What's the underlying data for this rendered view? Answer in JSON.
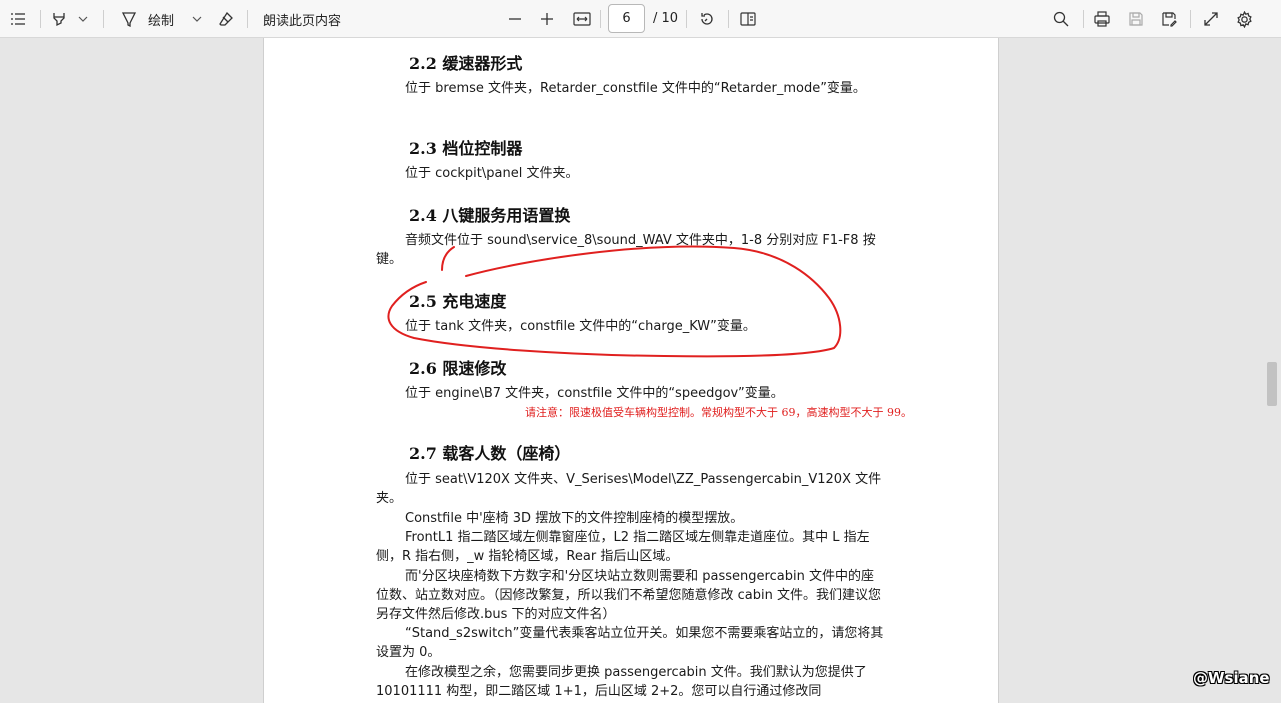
{
  "toolbar": {
    "draw_label": "绘制",
    "read_aloud_label": "朗读此页内容",
    "page_current": "6",
    "page_total": "/ 10"
  },
  "document": {
    "s22_title": "2.2 缓速器形式",
    "s22_body": "位于 bremse 文件夹，Retarder_constfile 文件中的“Retarder_mode”变量。",
    "s23_title": "2.3 档位控制器",
    "s23_body": "位于 cockpit\\panel 文件夹。",
    "s24_title": "2.4 八键服务用语置换",
    "s24_body": "音频文件位于 sound\\service_8\\sound_WAV 文件夹中，1-8 分别对应 F1-F8 按键。",
    "s25_title": "2.5 充电速度",
    "s25_body": "位于 tank 文件夹，constfile 文件中的“charge_KW”变量。",
    "s26_title": "2.6 限速修改",
    "s26_body": "位于 engine\\B7 文件夹，constfile 文件中的“speedgov”变量。",
    "s26_note": "请注意：限速极值受车辆构型控制。常规构型不大于 69，高速构型不大于 99。",
    "s27_title": "2.7 载客人数（座椅）",
    "s27_p1": "位于 seat\\V120X 文件夹、V_Serises\\Model\\ZZ_Passengercabin_V120X 文件夹。",
    "s27_p2": "Constfile 中'座椅 3D 摆放下的文件控制座椅的模型摆放。",
    "s27_p3": "FrontL1 指二踏区域左侧靠窗座位，L2 指二踏区域左侧靠走道座位。其中 L 指左侧，R 指右侧，_w 指轮椅区域，Rear 指后山区域。",
    "s27_p4": "而'分区块座椅数下方数字和'分区块站立数则需要和 passengercabin 文件中的座位数、站立数对应。（因修改繁复，所以我们不希望您随意修改 cabin 文件。我们建议您另存文件然后修改.bus 下的对应文件名）",
    "s27_p5": "“Stand_s2switch”变量代表乘客站立位开关。如果您不需要乘客站立的，请您将其设置为 0。",
    "s27_p6": "在修改模型之余，您需要同步更换 passengercabin 文件。我们默认为您提供了 10101111 构型，即二踏区域 1+1，后山区域 2+2。您可以自行通过修改同"
  },
  "watermark": "@Wsiane",
  "colors": {
    "annotation_ink": "#e0201f",
    "note_text": "#e0201f"
  }
}
